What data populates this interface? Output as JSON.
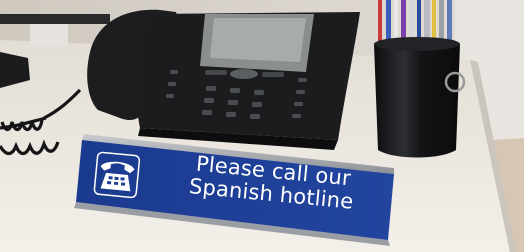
{
  "sign": {
    "line1": "Please call our",
    "line2": "Spanish hotline",
    "icon": "telephone-icon"
  },
  "colors": {
    "wall": "#d6d1ca",
    "desk": "#ece8df",
    "sign_blue": "#1d3f95",
    "phone_black": "#1b1b1d",
    "display_gray": "#9ea3a0",
    "cup_black": "#131315"
  }
}
